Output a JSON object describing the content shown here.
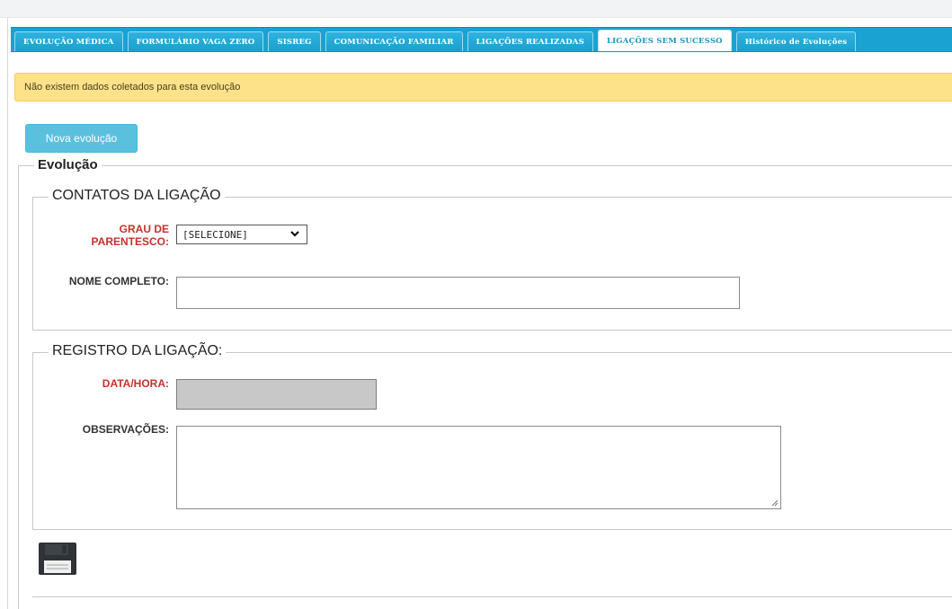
{
  "tabs": [
    {
      "label": "EVOLUÇÃO MÉDICA",
      "active": false
    },
    {
      "label": "FORMULÁRIO VAGA ZERO",
      "active": false
    },
    {
      "label": "SISREG",
      "active": false
    },
    {
      "label": "COMUNICAÇÃO FAMILIAR",
      "active": false
    },
    {
      "label": "LIGAÇÕES REALIZADAS",
      "active": false
    },
    {
      "label": "LIGAÇÕES SEM SUCESSO",
      "active": true
    },
    {
      "label": "Histórico de Evoluções",
      "active": false
    }
  ],
  "alert": {
    "message": "Não existem dados coletados para esta evolução"
  },
  "new_evolution_button": "Nova evolução",
  "evolucao": {
    "legend": "Evolução",
    "contatos": {
      "legend": "CONTATOS DA LIGAÇÃO",
      "grau_label_line1": "GRAU DE",
      "grau_label_line2": "PARENTESCO:",
      "grau_selected": "[SELECIONE]",
      "nome_label": "NOME COMPLETO:",
      "nome_value": ""
    },
    "registro": {
      "legend": "REGISTRO DA LIGAÇÃO:",
      "datahora_label": "DATA/HORA:",
      "datahora_value": "",
      "observacoes_label": "OBSERVAÇÕES:",
      "observacoes_value": ""
    }
  },
  "icons": {
    "save": "floppy-disk-icon",
    "select_arrow": "chevron-down-icon",
    "resize": "resize-grip-icon"
  },
  "colors": {
    "tab_bar": "#1aa3d2",
    "alert_bg": "#fde28a",
    "button": "#5bc0de",
    "required": "#c9302c"
  }
}
